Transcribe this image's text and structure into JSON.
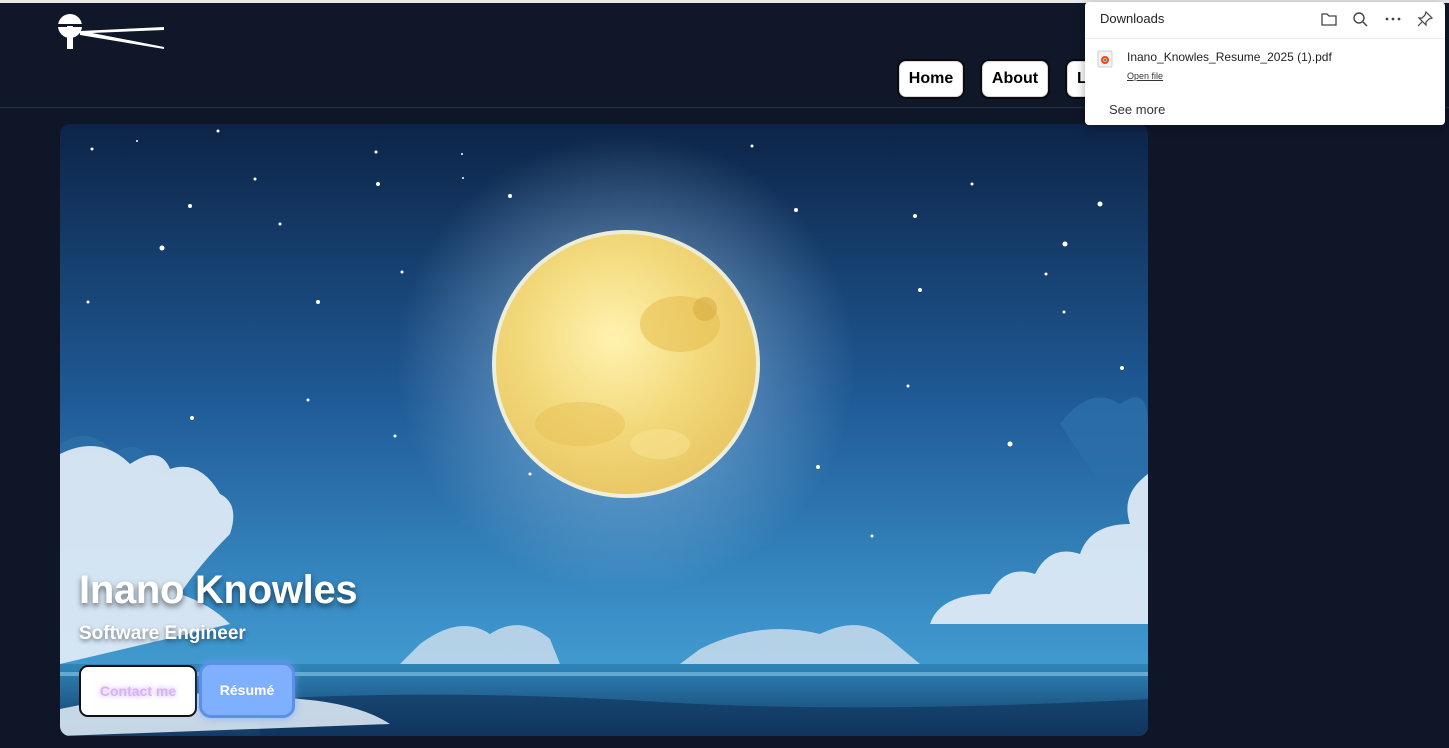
{
  "header": {
    "logo_alt": "logo",
    "nav": [
      {
        "label": "Home"
      },
      {
        "label": "About"
      },
      {
        "label": "L"
      }
    ]
  },
  "hero": {
    "title": "Inano Knowles",
    "subtitle": "Software Engineer",
    "contact_label": "Contact me",
    "resume_label": "Résumé"
  },
  "downloads": {
    "title": "Downloads",
    "icons": [
      "folder-icon",
      "search-icon",
      "more-icon",
      "pin-icon"
    ],
    "file": {
      "name": "Inano_Knowles_Resume_2025 (1).pdf",
      "action": "Open file"
    },
    "see_more": "See more"
  },
  "colors": {
    "page_bg": "#0e1628",
    "header_bg": "#0f1729",
    "resume_button": "#7fb0ff",
    "contact_text": "#d7b3f5"
  }
}
